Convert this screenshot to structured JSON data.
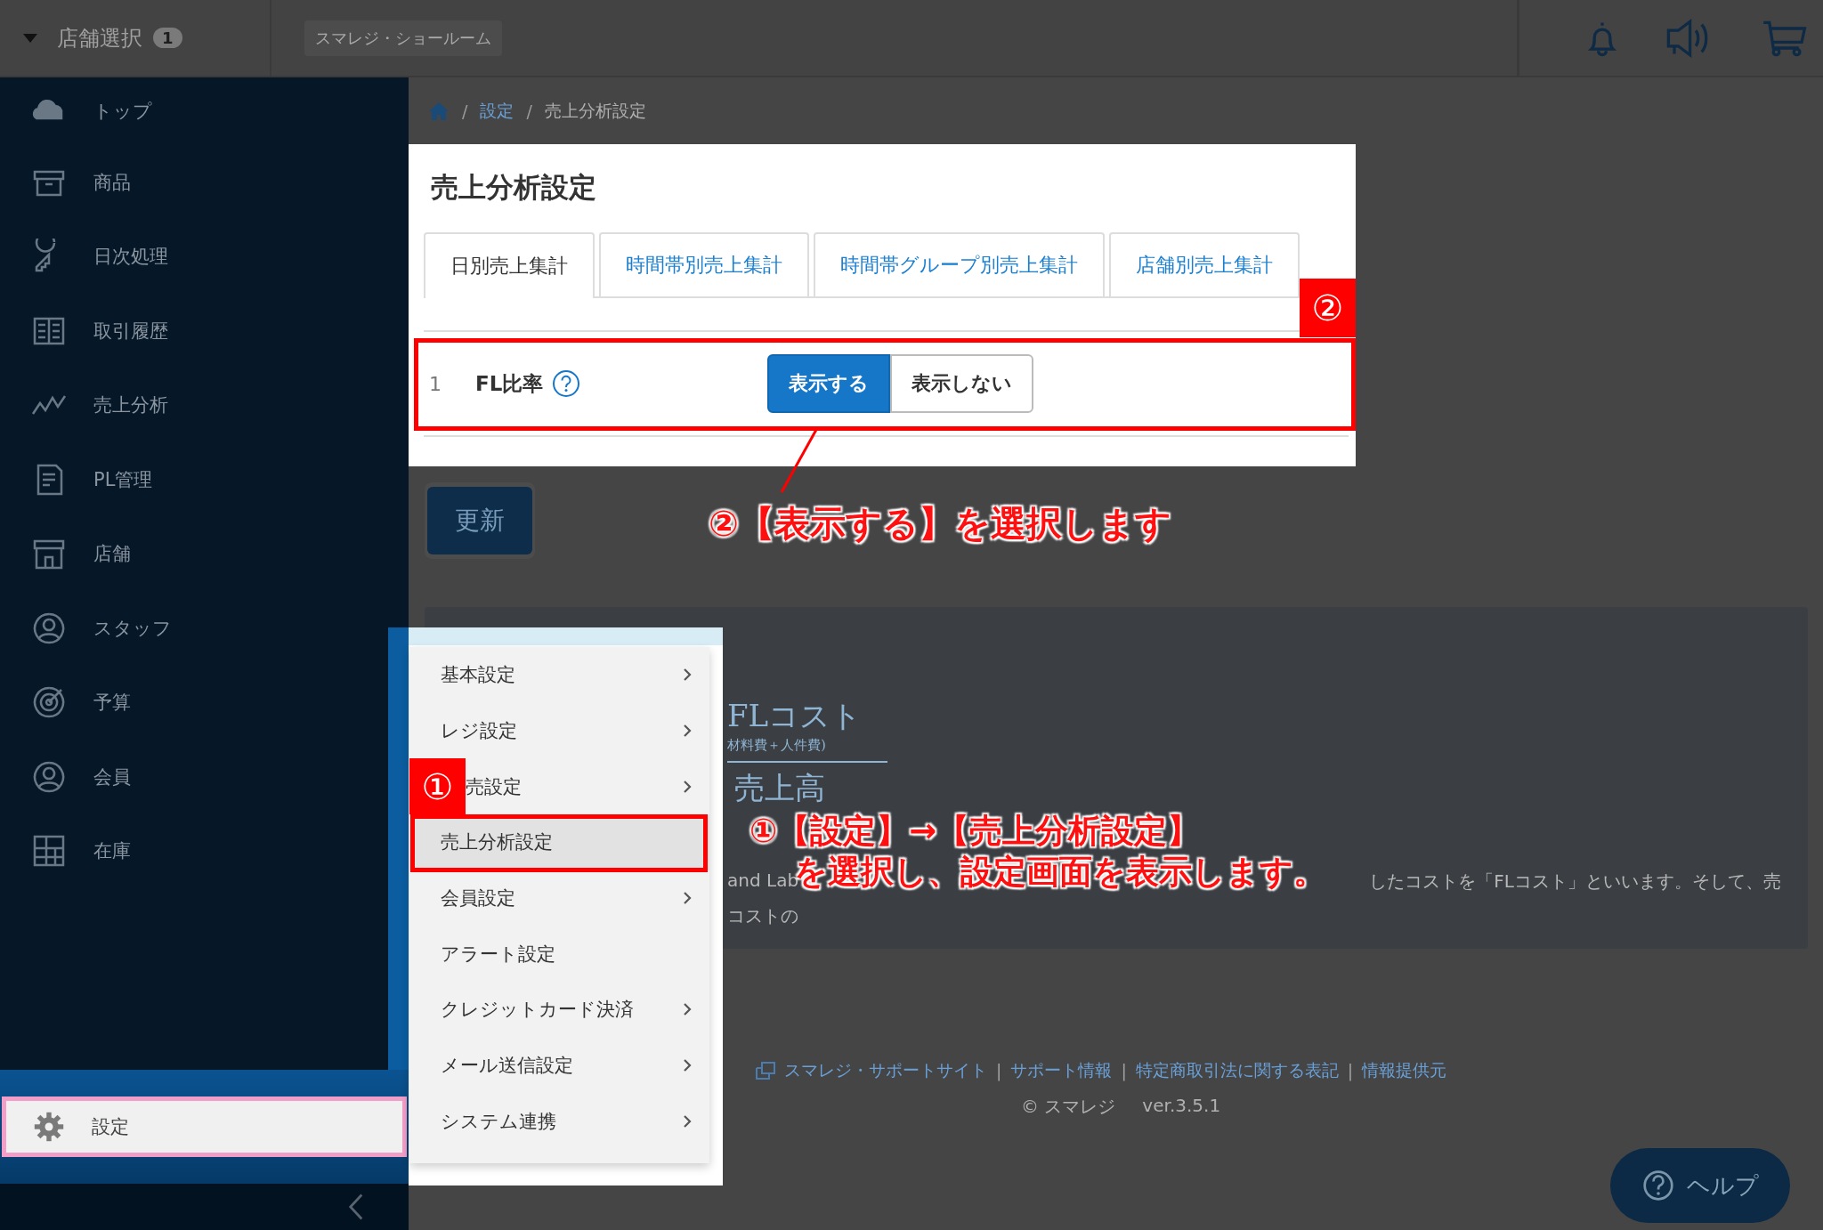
{
  "top_bar": {
    "store_selector": {
      "label": "店舗選択",
      "count": "1"
    },
    "store_name": "スマレジ・ショールーム"
  },
  "sidebar": {
    "items": [
      {
        "label": "トップ"
      },
      {
        "label": "商品"
      },
      {
        "label": "日次処理"
      },
      {
        "label": "取引履歴"
      },
      {
        "label": "売上分析"
      },
      {
        "label": "PL管理"
      },
      {
        "label": "店舗"
      },
      {
        "label": "スタッフ"
      },
      {
        "label": "予算"
      },
      {
        "label": "会員"
      },
      {
        "label": "在庫"
      }
    ],
    "settings_item": {
      "label": "設定",
      "annotated": true
    }
  },
  "breadcrumb": {
    "separators": [
      "/",
      "/"
    ],
    "link": "設定",
    "current": "売上分析設定"
  },
  "settings_panel": {
    "title": "売上分析設定",
    "tabs": [
      {
        "label": "日別売上集計",
        "selected": true
      },
      {
        "label": "時間帯別売上集計",
        "selected": false
      },
      {
        "label": "時間帯グループ別売上集計",
        "selected": false
      },
      {
        "label": "店舗別売上集計",
        "selected": false
      }
    ],
    "rows": [
      {
        "number": "1",
        "label": "FL比率",
        "annotated": true,
        "marker": "②",
        "options": [
          {
            "label": "表示する",
            "selected": true
          },
          {
            "label": "表示しない",
            "selected": false
          }
        ]
      }
    ]
  },
  "update_button": "更新",
  "info_box": {
    "formula_numerator": "FLコスト",
    "formula_note": "材料費＋人件費)",
    "formula_denominator": "売上高",
    "line_1_left": "and Lab",
    "line_1_right": "したコストを「FLコスト」といいます。そして、売",
    "line_2_left": "コストの"
  },
  "settings_menu": {
    "items": [
      {
        "label": "基本設定",
        "has_submenu": true,
        "selected": false,
        "annotated": false
      },
      {
        "label": "レジ設定",
        "has_submenu": true,
        "selected": false,
        "annotated": false
      },
      {
        "label": "売設定",
        "has_submenu": true,
        "selected": false,
        "annotated": false,
        "marker": "①"
      },
      {
        "label": "売上分析設定",
        "has_submenu": false,
        "selected": true,
        "annotated": true
      },
      {
        "label": "会員設定",
        "has_submenu": true,
        "selected": false,
        "annotated": false
      },
      {
        "label": "アラート設定",
        "has_submenu": false,
        "selected": false,
        "annotated": false
      },
      {
        "label": "クレジットカード決済",
        "has_submenu": true,
        "selected": false,
        "annotated": false
      },
      {
        "label": "メール送信設定",
        "has_submenu": true,
        "selected": false,
        "annotated": false
      },
      {
        "label": "システム連携",
        "has_submenu": true,
        "selected": false,
        "annotated": false
      }
    ]
  },
  "footer": {
    "links": [
      "スマレジ・サポートサイト",
      "サポート情報",
      "特定商取引法に関する表記",
      "情報提供元"
    ],
    "separators": [
      "|",
      "|",
      "|"
    ],
    "copyright": "© スマレジ",
    "version": "ver.3.5.1"
  },
  "help_button": "ヘルプ",
  "annotations": [
    {
      "lines": [
        "②【表示する】を選択します"
      ]
    },
    {
      "lines": [
        "①【設定】→【売上分析設定】",
        "を選択し、設定画面を表示します。"
      ]
    }
  ]
}
